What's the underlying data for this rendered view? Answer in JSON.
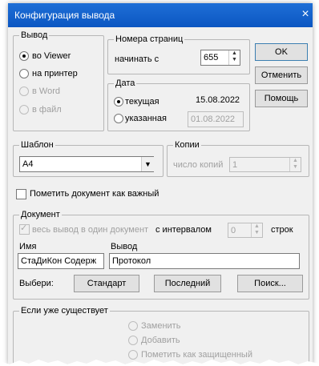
{
  "window": {
    "title": "Конфигурация вывода",
    "close_symbol": "×"
  },
  "output": {
    "label": "Вывод",
    "options": [
      "во Viewer",
      "на принтер",
      "в Word",
      "в файл"
    ]
  },
  "pages": {
    "label": "Номера страниц",
    "start_label": "начинать с",
    "start_value": "655"
  },
  "date": {
    "label": "Дата",
    "current_label": "текущая",
    "current_value": "15.08.2022",
    "specified_label": "указанная",
    "specified_value": "01.08.2022"
  },
  "buttons": {
    "ok": "OK",
    "cancel": "Отменить",
    "help": "Помощь"
  },
  "template": {
    "label": "Шаблон",
    "value": "A4"
  },
  "copies": {
    "label": "Копии",
    "count_label": "число копий",
    "count_value": "1"
  },
  "mark_important": "Пометить документ как важный",
  "document": {
    "label": "Документ",
    "all_output_label": "весь вывод в один документ",
    "interval_label": "с интервалом",
    "interval_value": "0",
    "rows_label": "строк",
    "name_label": "Имя",
    "name_value": "СтаДиКон Содерж",
    "output_label": "Вывод",
    "output_value": "Протокол",
    "choose_label": "Выбери:",
    "btn_standard": "Стандарт",
    "btn_last": "Последний",
    "btn_search": "Поиск..."
  },
  "exists": {
    "label": "Если уже существует",
    "options": [
      "Заменить",
      "Добавить",
      "Пометить как защищенный"
    ]
  }
}
